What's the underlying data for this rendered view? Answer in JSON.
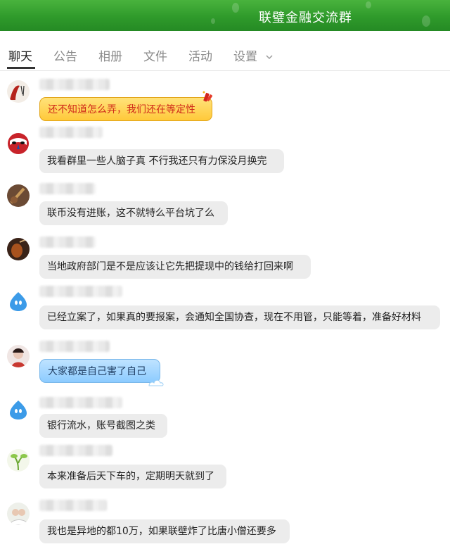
{
  "header": {
    "title": "联璧金融交流群"
  },
  "tabs": [
    {
      "label": "聊天",
      "active": true
    },
    {
      "label": "公告"
    },
    {
      "label": "相册"
    },
    {
      "label": "文件"
    },
    {
      "label": "活动"
    },
    {
      "label": "设置"
    }
  ],
  "messages": [
    {
      "text": "还不知道怎么弄，我们还在等定性",
      "style": "gold"
    },
    {
      "text": "我看群里一些人脑子真  不行我还只有力保没月换完"
    },
    {
      "text": "联币没有进账，这不就特么平台坑了么"
    },
    {
      "text": "当地政府部门是不是应该让它先把提现中的钱给打回来啊"
    },
    {
      "text": "已经立案了，如果真的要报案，会通知全国协查，现在不用管，只能等着，准备好材料"
    },
    {
      "text": "大家都是自己害了自己",
      "style": "blue"
    },
    {
      "text": "银行流水，账号截图之类"
    },
    {
      "text": "本来准备后天下车的，定期明天就到了"
    },
    {
      "text": "我也是异地的都10万，如果联壁炸了比唐小僧还要多"
    }
  ],
  "colors": {
    "header_green": "#2f9a2b",
    "bubble_gray": "#ececec",
    "gold": "#ffc93a",
    "blue": "#8ccbff"
  }
}
